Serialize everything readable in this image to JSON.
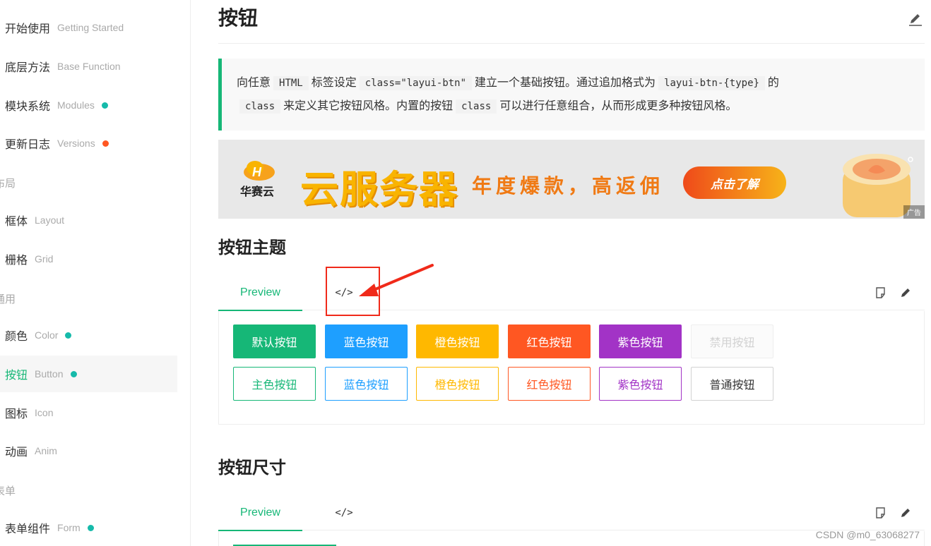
{
  "sidebar": {
    "items": [
      {
        "cn": "开始使用",
        "en": "Getting Started",
        "dot": ""
      },
      {
        "cn": "底层方法",
        "en": "Base Function",
        "dot": ""
      },
      {
        "cn": "模块系统",
        "en": "Modules",
        "dot": "#16baaa"
      },
      {
        "cn": "更新日志",
        "en": "Versions",
        "dot": "#ff5722"
      },
      {
        "group": "布局"
      },
      {
        "cn": "框体",
        "en": "Layout",
        "dot": ""
      },
      {
        "cn": "栅格",
        "en": "Grid",
        "dot": ""
      },
      {
        "group": "通用"
      },
      {
        "cn": "颜色",
        "en": "Color",
        "dot": "#16baaa"
      },
      {
        "cn": "按钮",
        "en": "Button",
        "dot": "#16baaa",
        "active": true
      },
      {
        "cn": "图标",
        "en": "Icon",
        "dot": ""
      },
      {
        "cn": "动画",
        "en": "Anim",
        "dot": ""
      },
      {
        "group": "表单"
      },
      {
        "cn": "表单组件",
        "en": "Form",
        "dot": "#16baaa"
      }
    ]
  },
  "page": {
    "title": "按钮",
    "intro": {
      "t1": "向任意",
      "c1": "HTML",
      "t2": "标签设定",
      "c2": "class=\"layui-btn\"",
      "t3": "建立一个基础按钮。通过追加格式为",
      "c3": "layui-btn-{type}",
      "t4": "的",
      "c4": "class",
      "t5": "来定义其它按钮风格。内置的按钮",
      "c5": "class",
      "t6": "可以进行任意组合，从而形成更多种按钮风格。"
    }
  },
  "ad": {
    "brand": "华赛云",
    "headline": "云服务器",
    "sub": "年度爆款，高返佣",
    "cta": "点击了解",
    "tag": "广告"
  },
  "section1": {
    "title": "按钮主题",
    "tab_preview": "Preview",
    "tab_code": "</>",
    "row1": [
      {
        "label": "默认按钮",
        "style": "solid",
        "color": "#16b777"
      },
      {
        "label": "蓝色按钮",
        "style": "solid",
        "color": "#1e9fff"
      },
      {
        "label": "橙色按钮",
        "style": "solid",
        "color": "#ffb800"
      },
      {
        "label": "红色按钮",
        "style": "solid",
        "color": "#ff5722"
      },
      {
        "label": "紫色按钮",
        "style": "solid",
        "color": "#a233c6"
      },
      {
        "label": "禁用按钮",
        "style": "disabled",
        "color": "#d2d2d2"
      }
    ],
    "row2": [
      {
        "label": "主色按钮",
        "style": "outline",
        "color": "#16b777"
      },
      {
        "label": "蓝色按钮",
        "style": "outline",
        "color": "#1e9fff"
      },
      {
        "label": "橙色按钮",
        "style": "outline",
        "color": "#ffb800"
      },
      {
        "label": "红色按钮",
        "style": "outline",
        "color": "#ff5722"
      },
      {
        "label": "紫色按钮",
        "style": "outline",
        "color": "#a233c6"
      },
      {
        "label": "普通按钮",
        "style": "outline",
        "color": "#333333"
      }
    ]
  },
  "section2": {
    "title": "按钮尺寸",
    "tab_preview": "Preview",
    "tab_code": "</>"
  },
  "watermark": "CSDN @m0_63068277"
}
